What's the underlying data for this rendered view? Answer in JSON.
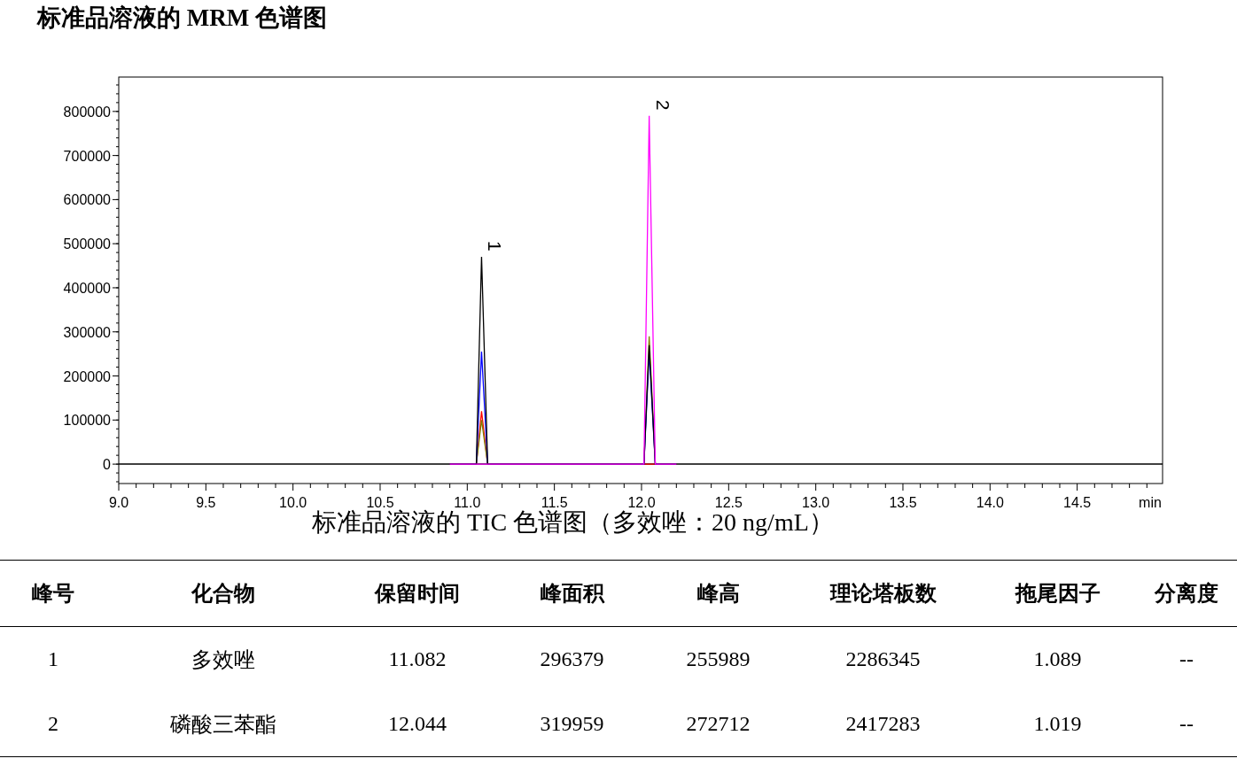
{
  "title": "标准品溶液的 MRM 色谱图",
  "chart": {
    "caption": "标准品溶液的 TIC 色谱图（多效唑：20 ng/mL）",
    "x_axis": {
      "label": "min",
      "ticks": [
        "9.0",
        "9.5",
        "10.0",
        "10.5",
        "11.0",
        "11.5",
        "12.0",
        "12.5",
        "13.0",
        "13.5",
        "14.0",
        "14.5"
      ]
    },
    "y_axis": {
      "ticks": [
        "800000",
        "700000",
        "600000",
        "500000",
        "400000",
        "300000",
        "200000",
        "100000",
        "0"
      ]
    },
    "peak_labels": [
      "1",
      "2"
    ]
  },
  "table": {
    "columns": [
      "峰号",
      "化合物",
      "保留时间",
      "峰面积",
      "峰高",
      "理论塔板数",
      "拖尾因子",
      "分离度"
    ],
    "rows": [
      [
        "1",
        "多效唑",
        "11.082",
        "296379",
        "255989",
        "2286345",
        "1.089",
        "--"
      ],
      [
        "2",
        "磷酸三苯酯",
        "12.044",
        "319959",
        "272712",
        "2417283",
        "1.019",
        "--"
      ]
    ]
  }
}
